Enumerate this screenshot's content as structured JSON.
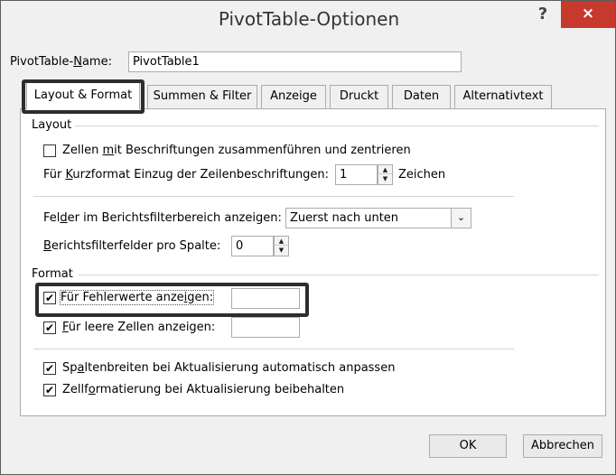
{
  "dialog": {
    "title": "PivotTable-Optionen",
    "help": "?",
    "close": "×"
  },
  "name_row": {
    "label_pre": "PivotTable-",
    "label_u": "N",
    "label_post": "ame:",
    "value": "PivotTable1"
  },
  "tabs": [
    {
      "label": "Layout & Format",
      "active": true
    },
    {
      "label": "Summen & Filter"
    },
    {
      "label": "Anzeige"
    },
    {
      "label": "Druckt"
    },
    {
      "label": "Daten"
    },
    {
      "label": "Alternativtext"
    }
  ],
  "layout_group": {
    "title": "Layout",
    "merge_pre": "Zellen ",
    "merge_u": "m",
    "merge_post": "it Beschriftungen zusammenführen und zentrieren",
    "merge_checked": false,
    "indent_pre": "Für ",
    "indent_u": "K",
    "indent_post": "urzformat Einzug der Zeilenbeschriftungen:",
    "indent_value": "1",
    "indent_unit": "Zeichen",
    "filter_area_pre": "Fel",
    "filter_area_u": "d",
    "filter_area_post": "er im Berichtsfilterbereich anzeigen:",
    "filter_area_value": "Zuerst nach unten",
    "filter_fields_pre": "",
    "filter_fields_u": "B",
    "filter_fields_post": "erichtsfilterfelder pro Spalte:",
    "filter_fields_value": "0"
  },
  "format_group": {
    "title": "Format",
    "errors_pre": "Für Fehlerwerte anze",
    "errors_u": "i",
    "errors_post": "gen:",
    "errors_checked": true,
    "errors_value": "",
    "empty_pre": "",
    "empty_u": "F",
    "empty_post": "ür leere Zellen anzeigen:",
    "empty_checked": true,
    "empty_value": "",
    "autofit_pre": "Sp",
    "autofit_u": "a",
    "autofit_post": "ltenbreiten bei Aktualisierung automatisch anpassen",
    "autofit_checked": true,
    "preserve_pre": "Zellf",
    "preserve_u": "o",
    "preserve_post": "rmatierung bei Aktualisierung beibehalten",
    "preserve_checked": true
  },
  "buttons": {
    "ok": "OK",
    "cancel": "Abbrechen"
  },
  "glyphs": {
    "check": "✔",
    "spin_up": "▲",
    "spin_down": "▼",
    "chevron": "⌄"
  }
}
